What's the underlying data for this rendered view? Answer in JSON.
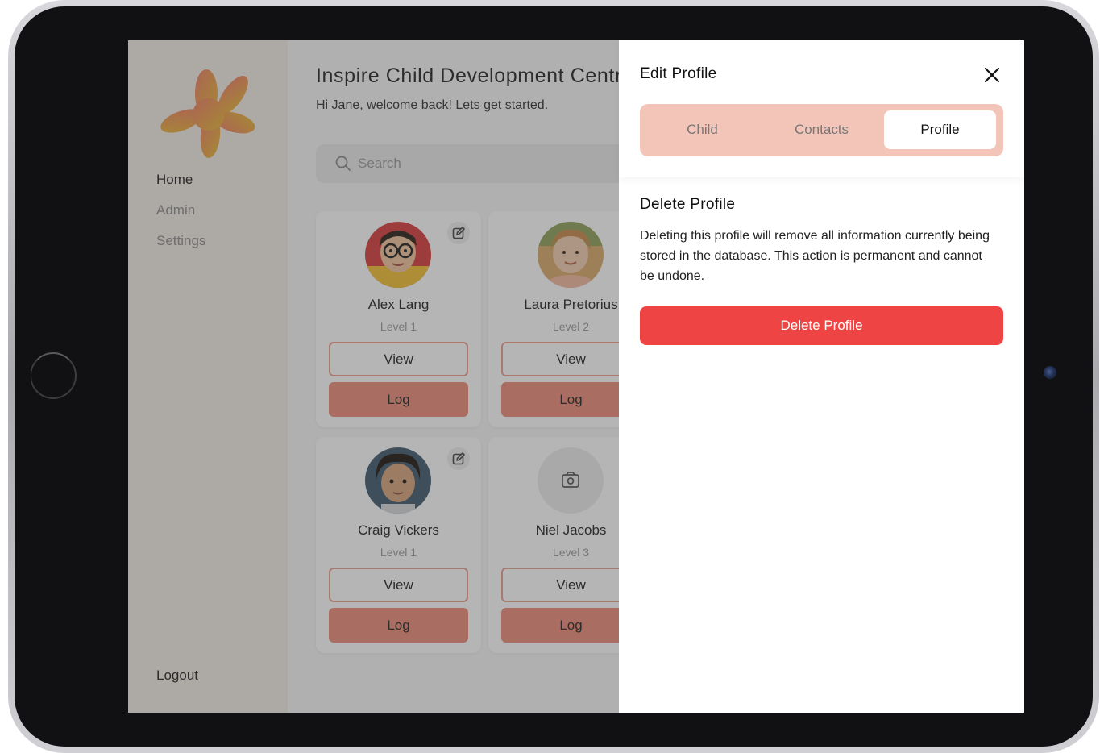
{
  "sidebar": {
    "items": [
      {
        "label": "Home",
        "active": true
      },
      {
        "label": "Admin",
        "active": false
      },
      {
        "label": "Settings",
        "active": false
      }
    ],
    "logout_label": "Logout"
  },
  "header": {
    "title": "Inspire Child Development Centre",
    "subtitle": "Hi Jane, welcome back! Lets get started."
  },
  "search": {
    "placeholder": "Search",
    "icon": "search-icon"
  },
  "children": [
    {
      "name": "Alex Lang",
      "level": "Level 1",
      "view_label": "View",
      "log_label": "Log",
      "avatar": "photo"
    },
    {
      "name": "Laura Pretorius",
      "level": "Level 2",
      "view_label": "View",
      "log_label": "Log",
      "avatar": "photo"
    },
    {
      "name": "Craig Vickers",
      "level": "Level 1",
      "view_label": "View",
      "log_label": "Log",
      "avatar": "photo"
    },
    {
      "name": "Niel Jacobs",
      "level": "Level 3",
      "view_label": "View",
      "log_label": "Log",
      "avatar": "camera-icon"
    }
  ],
  "drawer": {
    "title": "Edit Profile",
    "tabs": [
      {
        "label": "Child",
        "active": false
      },
      {
        "label": "Contacts",
        "active": false
      },
      {
        "label": "Profile",
        "active": true
      }
    ],
    "section_title": "Delete Profile",
    "section_desc": "Deleting this profile will remove all information currently being stored in the database. This action is permanent and cannot be undone.",
    "delete_label": "Delete Profile"
  },
  "colors": {
    "accent": "#ec8d78",
    "tab_bg": "#f3c5b9",
    "danger": "#ef4444",
    "sidebar_bg": "#f3ece5"
  }
}
